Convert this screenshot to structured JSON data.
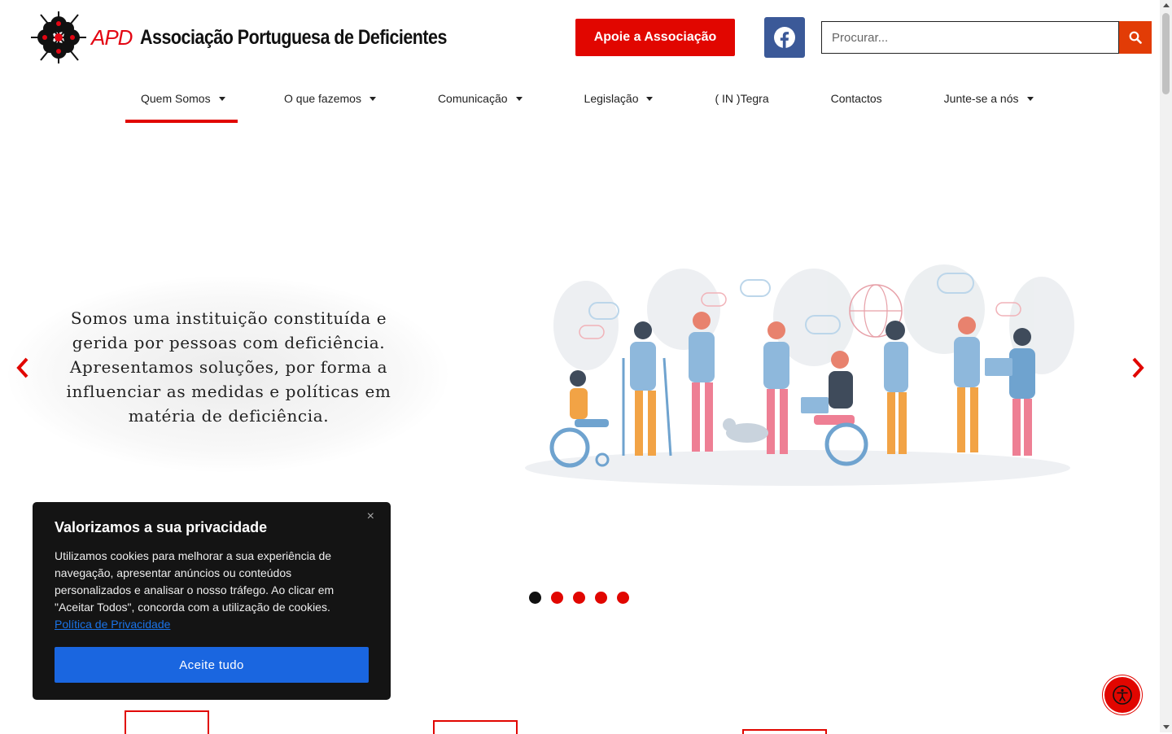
{
  "header": {
    "logo_acronym": "APD",
    "logo_name": "Associação Portuguesa de Deficientes",
    "donate_label": "Apoie a Associação",
    "facebook_icon": "facebook-icon",
    "search_placeholder": "Procurar...",
    "search_icon": "search-icon"
  },
  "nav": {
    "items": [
      {
        "label": "Quem Somos",
        "has_dropdown": true,
        "active": true
      },
      {
        "label": "O que fazemos",
        "has_dropdown": true
      },
      {
        "label": "Comunicação",
        "has_dropdown": true
      },
      {
        "label": "Legislação",
        "has_dropdown": true
      },
      {
        "label": "( IN )Tegra",
        "has_dropdown": false
      },
      {
        "label": "Contactos",
        "has_dropdown": false
      },
      {
        "label": "Junte-se a nós",
        "has_dropdown": true
      }
    ]
  },
  "hero": {
    "text": "Somos uma instituição constituída e gerida por pessoas com deficiência. Apresentamos soluções, por forma a influenciar as medidas e políticas em matéria de deficiência.",
    "slide_count": 5,
    "active_slide": 1
  },
  "cookie": {
    "title": "Valorizamos a sua privacidade",
    "body": "Utilizamos cookies para melhorar a sua experiência de navegação, apresentar anúncios ou conteúdos personalizados e analisar o nosso tráfego. Ao clicar em \"Aceitar Todos\", concorda com a utilização de cookies.",
    "policy_link": "Política de Privacidade",
    "accept_label": "Aceite tudo",
    "close_symbol": "×"
  },
  "colors": {
    "brand_red": "#e10600",
    "facebook_blue": "#3b5998",
    "accept_blue": "#1a66e0"
  }
}
